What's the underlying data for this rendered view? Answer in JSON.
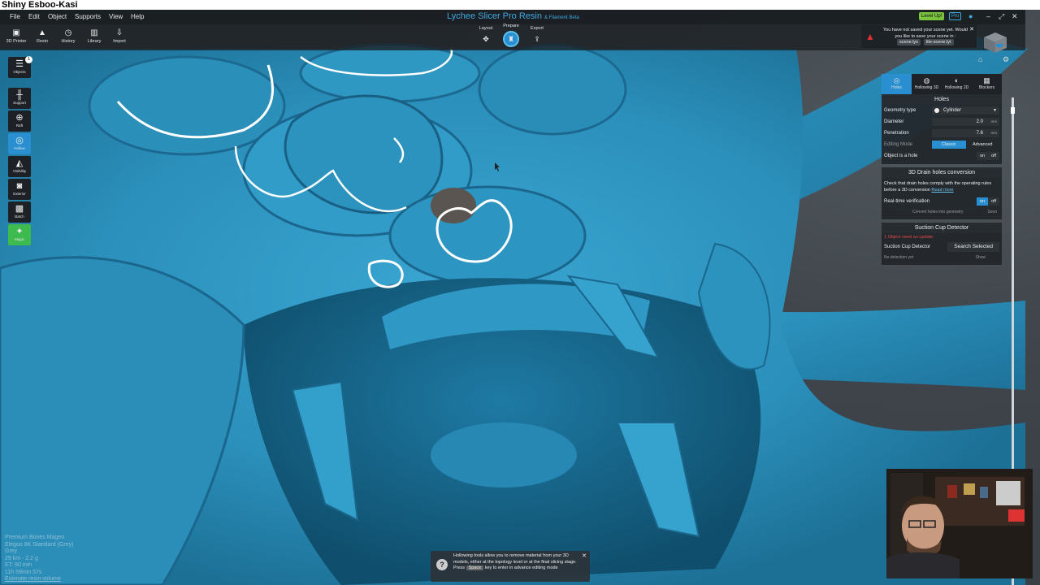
{
  "window_title": "Shiny Esboo-Kasi",
  "menu": [
    "File",
    "Edit",
    "Object",
    "Supports",
    "View",
    "Help"
  ],
  "app": {
    "name": "Lychee Slicer Pro Resin",
    "sub": "& Filament Beta",
    "level_up": "Level Up!",
    "pro": "Pro"
  },
  "toolbar": {
    "tools": [
      {
        "icon": "printer-icon",
        "glyph": "▣",
        "label": "3D Printer"
      },
      {
        "icon": "resin-icon",
        "glyph": "▲",
        "label": "Resin"
      },
      {
        "icon": "history-icon",
        "glyph": "◷",
        "label": "History"
      },
      {
        "icon": "library-icon",
        "glyph": "▥",
        "label": "Library"
      },
      {
        "icon": "import-icon",
        "glyph": "⇩",
        "label": "Import"
      }
    ],
    "steps": [
      {
        "label": "Layout",
        "glyph": "✥",
        "active": false
      },
      {
        "label": "Prepare",
        "glyph": "♜",
        "active": true
      },
      {
        "label": "Export",
        "glyph": "⇪",
        "active": false
      }
    ]
  },
  "notification": {
    "text": "You have not saved your scene yet. Would you like to save your scene in :",
    "option_1": "scene.lys",
    "option_2": "lite-scene.lyt"
  },
  "left_panel": [
    {
      "icon": "objects-icon",
      "glyph": "☰",
      "label": "Objects",
      "badge": "1",
      "state": ""
    },
    {
      "icon": "support-icon",
      "glyph": "╫",
      "label": "Support",
      "state": ""
    },
    {
      "icon": "raft-icon",
      "glyph": "⊕",
      "label": "Raft",
      "state": ""
    },
    {
      "icon": "hollow-icon",
      "glyph": "◎",
      "label": "Hollow",
      "state": "active"
    },
    {
      "icon": "visibility-icon",
      "glyph": "◭",
      "label": "Visibility",
      "state": ""
    },
    {
      "icon": "exterior-icon",
      "glyph": "◙",
      "label": "Exterior",
      "state": ""
    },
    {
      "icon": "batch-icon",
      "glyph": "▩",
      "label": "Batch",
      "state": ""
    },
    {
      "icon": "magic-icon",
      "glyph": "✦",
      "label": "Magic",
      "state": "green"
    }
  ],
  "right_panel": {
    "tabs": [
      {
        "label": "Holes",
        "glyph": "◎",
        "active": true
      },
      {
        "label": "Hollowing 3D",
        "glyph": "◍",
        "active": false
      },
      {
        "label": "Hollowing 2D",
        "glyph": "◐",
        "active": false
      },
      {
        "label": "Blockers",
        "glyph": "▦",
        "active": false
      }
    ],
    "holes": {
      "title": "Holes",
      "geometry_label": "Geometry type",
      "geometry_value": "Cylinder",
      "diameter_label": "Diameter",
      "diameter_value": "2.0",
      "diameter_unit": "mm",
      "penetration_label": "Penetration",
      "penetration_value": "7.6",
      "penetration_unit": "mm",
      "editing_label": "Editing Mode",
      "editing_classic": "Classic",
      "editing_advanced": "Advanced",
      "is_hole_label": "Object is a hole",
      "on": "on",
      "off": "off"
    },
    "drain": {
      "title": "3D Drain holes conversion",
      "text": "Check that drain holes comply with the operating rules before a 3D conversion",
      "read_more": "Read more",
      "realtime_label": "Real-time verification",
      "on": "on",
      "off": "off",
      "convert": "Convert holes into geometry",
      "soon": "Soon"
    },
    "suction": {
      "title": "Suction Cup Detector",
      "warning": "1 Object need an update",
      "label": "Suction Cup Detector",
      "button": "Search Selected",
      "status": "No detection yet",
      "show": "Show"
    }
  },
  "hint": {
    "text": "Hollowing tools allow you to remove material from your 3D models, either at the topology level or at the final slicing stage.",
    "press": "Press",
    "key": "Space",
    "rest": "key to enter in advance editing mode"
  },
  "info_lines": [
    "Premium Bones Mageo",
    "Elegoo 8K Standard (Grey)",
    "Grey",
    "29 km - 2.2 g",
    "ET: 90 min",
    "11h 59min 57s"
  ],
  "info_link": "Estimate resin volume",
  "colors": {
    "accent": "#2a8fd0",
    "model": "#2b94bf",
    "highlight": "#ffffff"
  }
}
